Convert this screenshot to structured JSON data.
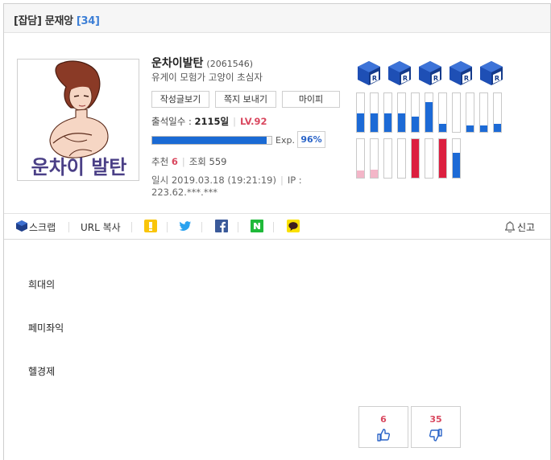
{
  "post": {
    "category": "[잡담]",
    "title": "문재앙",
    "comment_count": "[34]"
  },
  "profile": {
    "username": "운차이발탄",
    "user_id": "(2061546)",
    "status": "유게이 모험가 고양이 초심자",
    "avatar_text": "운차이 발탄",
    "buttons": {
      "posts": "작성글보기",
      "message": "쪽지 보내기",
      "mypi": "마이피"
    },
    "attendance_label": "출석일수 :",
    "attendance_value": "2115일",
    "level": "LV.92",
    "exp_label": "Exp.",
    "exp_percent": "96%",
    "exp_fraction": 0.96,
    "recommend_label": "추천",
    "recommend_value": "6",
    "views_label": "조회",
    "views_value": "559",
    "date_text": "일시 2019.03.18 (19:21:19)",
    "ip_label": "IP :",
    "ip_value": "223.62.***.***",
    "badge_icon": "r-cube-icon",
    "badge_count": 5,
    "stats_top": [
      {
        "fill": 0.48,
        "color": "#1c6ad6"
      },
      {
        "fill": 0.48,
        "color": "#1c6ad6"
      },
      {
        "fill": 0.48,
        "color": "#1c6ad6"
      },
      {
        "fill": 0.48,
        "color": "#1c6ad6"
      },
      {
        "fill": 0.4,
        "color": "#1c6ad6"
      },
      {
        "fill": 0.78,
        "color": "#1c6ad6"
      },
      {
        "fill": 0.2,
        "color": "#1c6ad6"
      },
      {
        "fill": 0.0,
        "color": "#1c6ad6"
      },
      {
        "fill": 0.16,
        "color": "#1c6ad6"
      },
      {
        "fill": 0.16,
        "color": "#1c6ad6"
      },
      {
        "fill": 0.2,
        "color": "#1c6ad6"
      }
    ],
    "stats_bottom": [
      {
        "fill": 0.18,
        "color": "#f3b6c8"
      },
      {
        "fill": 0.2,
        "color": "#f3b6c8"
      },
      {
        "fill": 0.0,
        "color": "#f3b6c8"
      },
      {
        "fill": 0.0,
        "color": "#f3b6c8"
      },
      {
        "fill": 1.0,
        "color": "#dc1f3f"
      },
      {
        "fill": 0.0,
        "color": "#dc1f3f"
      },
      {
        "fill": 1.0,
        "color": "#dc1f3f"
      },
      {
        "fill": 0.64,
        "color": "#1c6ad6"
      }
    ]
  },
  "share": {
    "scrap": "스크랩",
    "url_copy": "URL 복사",
    "report": "신고",
    "icons": [
      "kakaostory-icon",
      "twitter-icon",
      "facebook-icon",
      "naver-icon",
      "kakaotalk-icon"
    ]
  },
  "content": {
    "paragraphs": [
      "희대의",
      "페미좌익",
      "헬경제"
    ]
  },
  "votes": {
    "up": "6",
    "down": "35"
  },
  "colors": {
    "accent": "#3d7fd6",
    "level": "#d9485f",
    "exp_bar": "#1a6ad4"
  }
}
